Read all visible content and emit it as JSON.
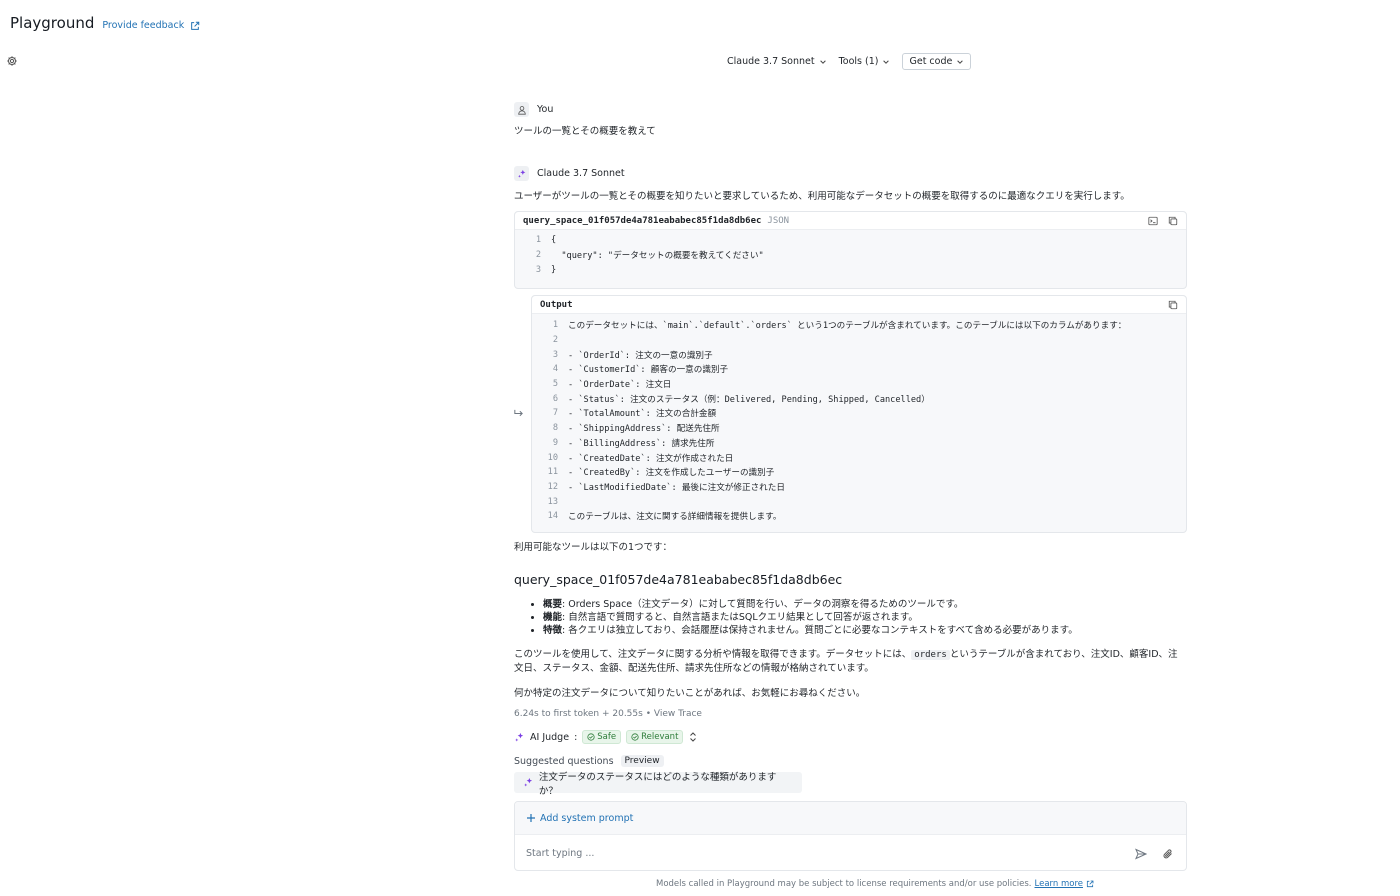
{
  "header": {
    "title": "Playground",
    "feedback_label": "Provide feedback"
  },
  "toolbar": {
    "model": "Claude 3.7 Sonnet",
    "tools": "Tools (1)",
    "get_code": "Get code"
  },
  "conversation": {
    "user_label": "You",
    "user_message": "ツールの一覧とその概要を教えて",
    "assistant_label": "Claude 3.7 Sonnet",
    "assistant_intro": "ユーザーがツールの一覧とその概要を知りたいと要求しているため、利用可能なデータセットの概要を取得するのに最適なクエリを実行します。",
    "tool_call": {
      "name": "query_space_01f057de4a781eababec85f1da8db6ec",
      "lang": "JSON",
      "lines": [
        {
          "n": "1",
          "t": "{"
        },
        {
          "n": "2",
          "t": "  \"query\": \"データセットの概要を教えてください\""
        },
        {
          "n": "3",
          "t": "}"
        }
      ]
    },
    "output": {
      "label": "Output",
      "lines": [
        {
          "n": "1",
          "t": "このデータセットには、`main`.`default`.`orders` という1つのテーブルが含まれています。このテーブルには以下のカラムがあります："
        },
        {
          "n": "2",
          "t": ""
        },
        {
          "n": "3",
          "t": "- `OrderId`: 注文の一意の識別子"
        },
        {
          "n": "4",
          "t": "- `CustomerId`: 顧客の一意の識別子"
        },
        {
          "n": "5",
          "t": "- `OrderDate`: 注文日"
        },
        {
          "n": "6",
          "t": "- `Status`: 注文のステータス（例：Delivered, Pending, Shipped, Cancelled）"
        },
        {
          "n": "7",
          "t": "- `TotalAmount`: 注文の合計金額"
        },
        {
          "n": "8",
          "t": "- `ShippingAddress`: 配送先住所"
        },
        {
          "n": "9",
          "t": "- `BillingAddress`: 請求先住所"
        },
        {
          "n": "10",
          "t": "- `CreatedDate`: 注文が作成された日"
        },
        {
          "n": "11",
          "t": "- `CreatedBy`: 注文を作成したユーザーの識別子"
        },
        {
          "n": "12",
          "t": "- `LastModifiedDate`: 最後に注文が修正された日"
        },
        {
          "n": "13",
          "t": ""
        },
        {
          "n": "14",
          "t": "このテーブルは、注文に関する詳細情報を提供します。"
        }
      ]
    },
    "answer": {
      "available_tools": "利用可能なツールは以下の1つです：",
      "tool_title": "query_space_01f057de4a781eababec85f1da8db6ec",
      "bullets": [
        {
          "label": "概要",
          "text": ": Orders Space（注文データ）に対して質問を行い、データの洞察を得るためのツールです。"
        },
        {
          "label": "機能",
          "text": ": 自然言語で質問すると、自然言語またはSQLクエリ結果として回答が返されます。"
        },
        {
          "label": "特徴",
          "text": ": 各クエリは独立しており、会話履歴は保持されません。質問ごとに必要なコンテキストをすべて含める必要があります。"
        }
      ],
      "para1_before": "このツールを使用して、注文データに関する分析や情報を取得できます。データセットには、",
      "para1_code": "orders",
      "para1_after": "というテーブルが含まれており、注文ID、顧客ID、注文日、ステータス、金額、配送先住所、請求先住所などの情報が格納されています。",
      "para2": "何か特定の注文データについて知りたいことがあれば、お気軽にお尋ねください。"
    },
    "timing": "6.24s to first token + 20.55s",
    "view_trace": "View Trace",
    "judge": {
      "label": "AI Judge",
      "colon": ":",
      "safe": "Safe",
      "relevant": "Relevant"
    },
    "suggested": {
      "label": "Suggested questions",
      "preview": "Preview",
      "question": "注文データのステータスにはどのような種類がありますか？"
    }
  },
  "input": {
    "add_system_prompt": "Add system prompt",
    "placeholder": "Start typing ..."
  },
  "footer": {
    "text": "Models called in Playground may be subject to license requirements and/or use policies.",
    "link": "Learn more"
  },
  "colors": {
    "link": "#2272b4",
    "safe_green": "#2e7d3a",
    "accent_purple": "#7b3fe4"
  }
}
